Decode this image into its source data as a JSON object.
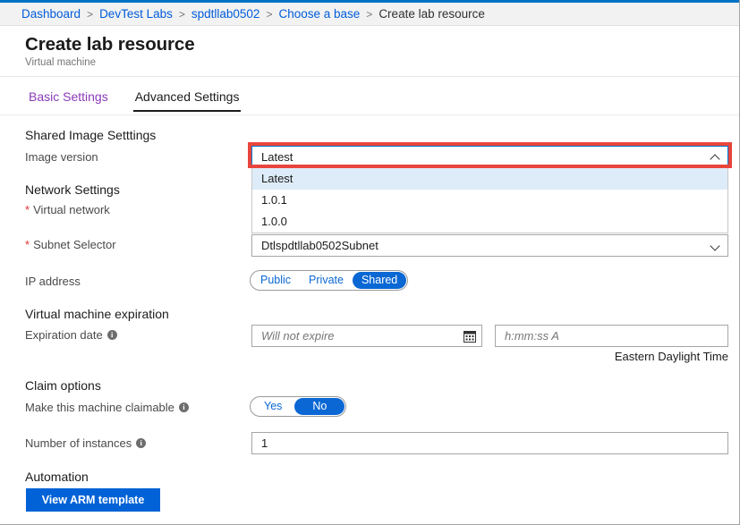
{
  "breadcrumb": {
    "separator": ">",
    "items": [
      {
        "label": "Dashboard",
        "current": false
      },
      {
        "label": "DevTest Labs",
        "current": false
      },
      {
        "label": "spdtllab0502",
        "current": false
      },
      {
        "label": "Choose a base",
        "current": false
      },
      {
        "label": "Create lab resource",
        "current": true
      }
    ]
  },
  "header": {
    "title": "Create lab resource",
    "subtitle": "Virtual machine"
  },
  "tabs": [
    {
      "label": "Basic Settings",
      "state": "visited"
    },
    {
      "label": "Advanced Settings",
      "state": "active"
    }
  ],
  "sections": {
    "shared_image": {
      "heading": "Shared Image Setttings",
      "image_version": {
        "label": "Image version",
        "value": "Latest",
        "chevron": "chevron-up-icon",
        "expanded": true,
        "options": [
          {
            "label": "Latest",
            "selected": true
          },
          {
            "label": "1.0.1",
            "selected": false
          },
          {
            "label": "1.0.0",
            "selected": false
          }
        ]
      }
    },
    "network": {
      "heading": "Network Settings",
      "virtual_network": {
        "label": "Virtual network",
        "required": true,
        "star": "*"
      },
      "subnet_selector": {
        "label": "Subnet Selector",
        "required": true,
        "star": "*",
        "value": "Dtlspdtllab0502Subnet",
        "chevron": "chevron-down-icon"
      },
      "ip_address": {
        "label": "IP address",
        "options": [
          {
            "label": "Public",
            "selected": false
          },
          {
            "label": "Private",
            "selected": false
          },
          {
            "label": "Shared",
            "selected": true
          }
        ]
      }
    },
    "expiration": {
      "heading": "Virtual machine expiration",
      "expiration_date": {
        "label": "Expiration date",
        "info": "info-icon",
        "date_placeholder": "Will not expire",
        "date_value": "",
        "calendar_icon": "calendar-icon",
        "time_placeholder": "h:mm:ss A",
        "time_value": "",
        "timezone": "Eastern Daylight Time"
      }
    },
    "claim": {
      "heading": "Claim options",
      "claimable": {
        "label": "Make this machine claimable",
        "info": "info-icon",
        "options": [
          {
            "label": "Yes",
            "selected": false
          },
          {
            "label": "No",
            "selected": true
          }
        ]
      },
      "instances": {
        "label": "Number of instances",
        "info": "info-icon",
        "value": "1"
      }
    },
    "automation": {
      "heading": "Automation",
      "view_arm_template_button": "View ARM template"
    }
  },
  "colors": {
    "accent_blue": "#0062d6",
    "toggle_blue": "#0a67d4",
    "link_blue": "#015cda",
    "visited_purple": "#8a3ab9",
    "required_red": "#e02f2f",
    "annotation_red": "#e8453c",
    "dropdown_highlight": "#deecf9",
    "top_strip": "#0072c6"
  }
}
